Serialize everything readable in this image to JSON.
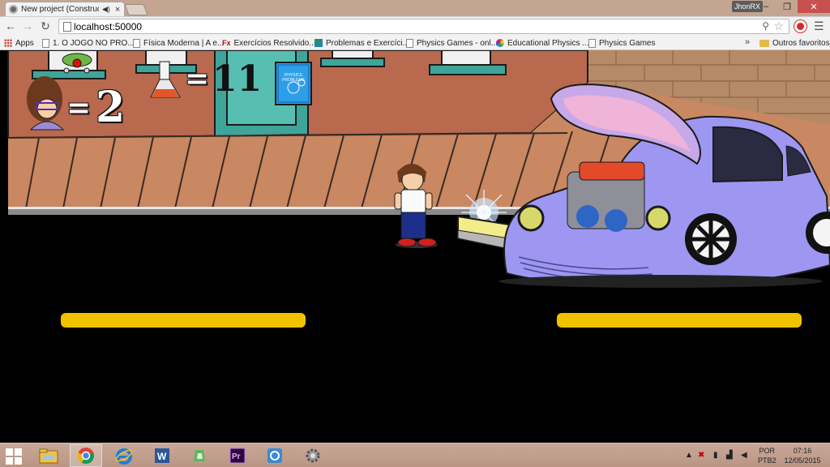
{
  "browser": {
    "tab": {
      "title": "New project (Construct",
      "icon": "construct-favicon"
    },
    "user_name": "JhonRX",
    "address": "localhost:50000",
    "bookmarks": [
      {
        "label": "Apps",
        "icon": "apps-grid-icon"
      },
      {
        "label": "1. O JOGO NO PRO...",
        "icon": "page-icon"
      },
      {
        "label": "Física Moderna | A e...",
        "icon": "page-icon"
      },
      {
        "label": "Exercícios Resolvido...",
        "icon": "fx-icon"
      },
      {
        "label": "Problemas e Exercíci...",
        "icon": "green-square-icon"
      },
      {
        "label": "Physics Games - onl...",
        "icon": "page-icon"
      },
      {
        "label": "Educational Physics ...",
        "icon": "rainbow-icon"
      },
      {
        "label": "Physics Games",
        "icon": "page-icon"
      }
    ],
    "bookmarks_more": "»",
    "other_bookmarks": "Outros favoritos"
  },
  "game": {
    "hud": {
      "lives_symbol": "=",
      "lives_count": "2",
      "flasks_symbol": "=",
      "flasks_count": "11"
    },
    "book_title": "PHYSICS PROBLEMS",
    "colors": {
      "building": "#b8694e",
      "sidewalk": "#c98762",
      "road": "#000000",
      "lane_marking": "#f2c200",
      "car": "#9d97f2"
    }
  },
  "taskbar": {
    "apps": [
      {
        "name": "file-explorer-icon"
      },
      {
        "name": "chrome-icon",
        "active": true
      },
      {
        "name": "internet-explorer-icon"
      },
      {
        "name": "word-icon"
      },
      {
        "name": "camtasia-icon"
      },
      {
        "name": "premiere-icon"
      },
      {
        "name": "app-blue-icon"
      },
      {
        "name": "settings-gear-icon"
      }
    ],
    "language_line1": "POR",
    "language_line2": "PTB2",
    "time": "07:16",
    "date": "12/05/2015"
  }
}
